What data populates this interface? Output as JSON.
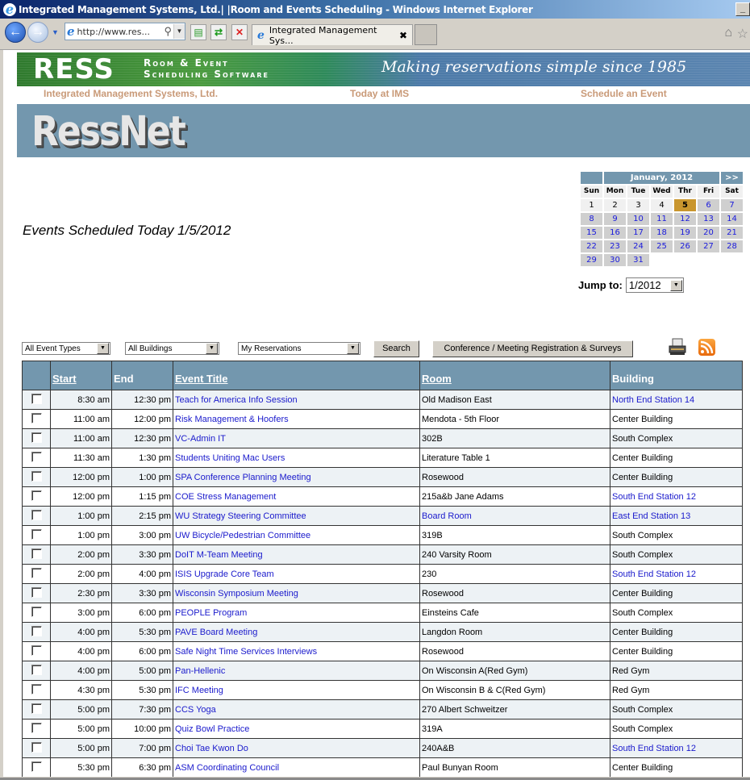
{
  "browser": {
    "window_title": "Integrated Management Systems, Ltd.| |Room and Events Scheduling - Windows Internet Explorer",
    "address": "http://www.res...",
    "tab_title": "Integrated Management Sys...",
    "tab_close": "x",
    "minimize": "_"
  },
  "banner": {
    "brand": "RESS",
    "sub_line1": "Room & Event",
    "sub_line2": "Scheduling Software",
    "tagline": "Making reservations simple since 1985"
  },
  "topnav": [
    "Integrated Management Systems, Ltd.",
    "Today at IMS",
    "Schedule an Event"
  ],
  "ressnet_logo": "RessNet",
  "heading": "Events Scheduled Today 1/5/2012",
  "calendar": {
    "month_label": "January, 2012",
    "next_label": ">>",
    "days_of_week": [
      "Sun",
      "Mon",
      "Tue",
      "Wed",
      "Thr",
      "Fri",
      "Sat"
    ],
    "weeks": [
      [
        "1",
        "2",
        "3",
        "4",
        "5",
        "6",
        "7"
      ],
      [
        "8",
        "9",
        "10",
        "11",
        "12",
        "13",
        "14"
      ],
      [
        "15",
        "16",
        "17",
        "18",
        "19",
        "20",
        "21"
      ],
      [
        "22",
        "23",
        "24",
        "25",
        "26",
        "27",
        "28"
      ],
      [
        "29",
        "30",
        "31",
        "",
        "",
        "",
        ""
      ]
    ],
    "today": "5",
    "jump_label": "Jump to:",
    "jump_value": "1/2012"
  },
  "filters": {
    "event_types": "All Event Types",
    "buildings": "All Buildings",
    "reservations": "My Reservations",
    "search_label": "Search",
    "conference_label": "Conference / Meeting Registration & Surveys"
  },
  "table": {
    "headers": {
      "start": "Start",
      "end": "End",
      "title": "Event Title",
      "room": "Room",
      "building": "Building"
    },
    "rows": [
      {
        "start": "8:30 am",
        "end": "12:30 pm",
        "title": "Teach for America Info Session",
        "room": "Old Madison East",
        "room_link": false,
        "building": "North End Station 14",
        "building_link": true
      },
      {
        "start": "11:00 am",
        "end": "12:00 pm",
        "title": "Risk Management & Hoofers",
        "room": "Mendota - 5th Floor",
        "room_link": false,
        "building": "Center Building",
        "building_link": false
      },
      {
        "start": "11:00 am",
        "end": "12:30 pm",
        "title": "VC-Admin IT",
        "room": "302B",
        "room_link": false,
        "building": "South Complex",
        "building_link": false
      },
      {
        "start": "11:30 am",
        "end": "1:30 pm",
        "title": "Students Uniting Mac Users",
        "room": "Literature Table 1",
        "room_link": false,
        "building": "Center Building",
        "building_link": false
      },
      {
        "start": "12:00 pm",
        "end": "1:00 pm",
        "title": "SPA Conference Planning Meeting",
        "room": "Rosewood",
        "room_link": false,
        "building": "Center Building",
        "building_link": false
      },
      {
        "start": "12:00 pm",
        "end": "1:15 pm",
        "title": "COE Stress Management",
        "room": "215a&b Jane Adams",
        "room_link": false,
        "building": "South End Station 12",
        "building_link": true
      },
      {
        "start": "1:00 pm",
        "end": "2:15 pm",
        "title": "WU Strategy Steering Committee",
        "room": "Board Room",
        "room_link": true,
        "building": "East End Station 13",
        "building_link": true
      },
      {
        "start": "1:00 pm",
        "end": "3:00 pm",
        "title": "UW Bicycle/Pedestrian Committee",
        "room": "319B",
        "room_link": false,
        "building": "South Complex",
        "building_link": false
      },
      {
        "start": "2:00 pm",
        "end": "3:30 pm",
        "title": "DoIT M-Team Meeting",
        "room": "240 Varsity Room",
        "room_link": false,
        "building": "South Complex",
        "building_link": false
      },
      {
        "start": "2:00 pm",
        "end": "4:00 pm",
        "title": "ISIS Upgrade Core Team",
        "room": "230",
        "room_link": false,
        "building": "South End Station 12",
        "building_link": true
      },
      {
        "start": "2:30 pm",
        "end": "3:30 pm",
        "title": "Wisconsin Symposium Meeting",
        "room": "Rosewood",
        "room_link": false,
        "building": "Center Building",
        "building_link": false
      },
      {
        "start": "3:00 pm",
        "end": "6:00 pm",
        "title": "PEOPLE Program",
        "room": "Einsteins Cafe",
        "room_link": false,
        "building": "South Complex",
        "building_link": false
      },
      {
        "start": "4:00 pm",
        "end": "5:30 pm",
        "title": "PAVE Board Meeting",
        "room": "Langdon Room",
        "room_link": false,
        "building": "Center Building",
        "building_link": false
      },
      {
        "start": "4:00 pm",
        "end": "6:00 pm",
        "title": "Safe Night Time Services Interviews",
        "room": "Rosewood",
        "room_link": false,
        "building": "Center Building",
        "building_link": false
      },
      {
        "start": "4:00 pm",
        "end": "5:00 pm",
        "title": "Pan-Hellenic",
        "room": "On Wisconsin A(Red Gym)",
        "room_link": false,
        "building": "Red Gym",
        "building_link": false
      },
      {
        "start": "4:30 pm",
        "end": "5:30 pm",
        "title": "IFC Meeting",
        "room": "On Wisconsin B & C(Red Gym)",
        "room_link": false,
        "building": "Red Gym",
        "building_link": false
      },
      {
        "start": "5:00 pm",
        "end": "7:30 pm",
        "title": "CCS Yoga",
        "room": "270 Albert Schweitzer",
        "room_link": false,
        "building": "South Complex",
        "building_link": false
      },
      {
        "start": "5:00 pm",
        "end": "10:00 pm",
        "title": "Quiz Bowl Practice",
        "room": "319A",
        "room_link": false,
        "building": "South Complex",
        "building_link": false
      },
      {
        "start": "5:00 pm",
        "end": "7:00 pm",
        "title": "Choi Tae Kwon Do",
        "room": "240A&B",
        "room_link": false,
        "building": "South End Station 12",
        "building_link": true
      },
      {
        "start": "5:30 pm",
        "end": "6:30 pm",
        "title": "ASM Coordinating Council",
        "room": "Paul Bunyan Room",
        "room_link": false,
        "building": "Center Building",
        "building_link": false
      }
    ]
  }
}
